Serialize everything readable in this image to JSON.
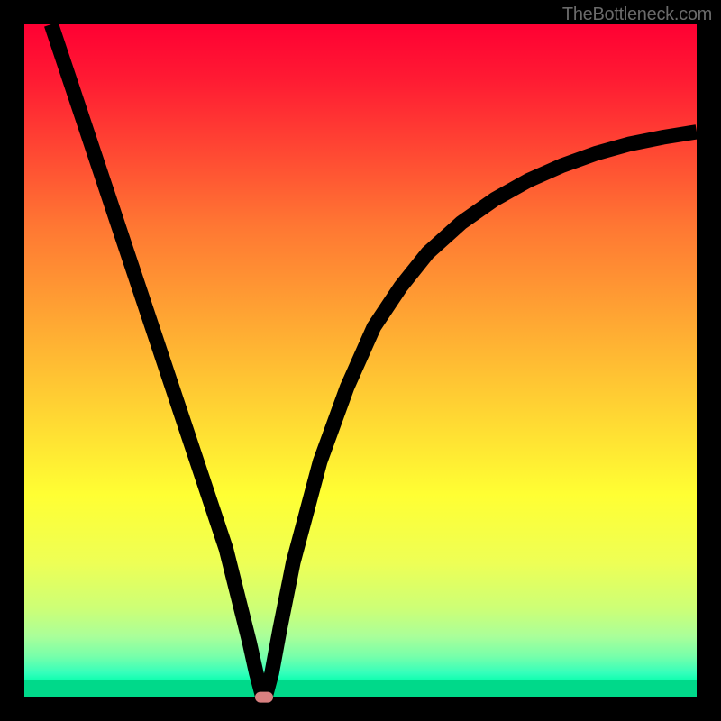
{
  "watermark": "TheBottleneck.com",
  "chart_data": {
    "type": "line",
    "title": "",
    "xlabel": "",
    "ylabel": "",
    "xlim": [
      0,
      100
    ],
    "ylim": [
      0,
      100
    ],
    "x": [
      4,
      8,
      12,
      16,
      20,
      24,
      28,
      30,
      32,
      33.5,
      34.5,
      35.3,
      36,
      36.8,
      38,
      40,
      44,
      48,
      52,
      56,
      60,
      65,
      70,
      75,
      80,
      85,
      90,
      95,
      100
    ],
    "values": [
      100,
      88,
      76,
      64,
      52,
      40,
      28,
      22,
      14,
      8,
      3.5,
      0.5,
      0.5,
      3.5,
      10,
      20,
      35,
      46,
      55,
      61,
      66,
      70.5,
      74,
      76.8,
      79,
      80.8,
      82.2,
      83.2,
      84
    ],
    "minimum_point": {
      "x": 35.6,
      "y": 0
    }
  },
  "accent_colors": {
    "gradient_top": "#ff0033",
    "gradient_bottom": "#00d98a",
    "curve": "#000000",
    "dot": "#d88080"
  }
}
